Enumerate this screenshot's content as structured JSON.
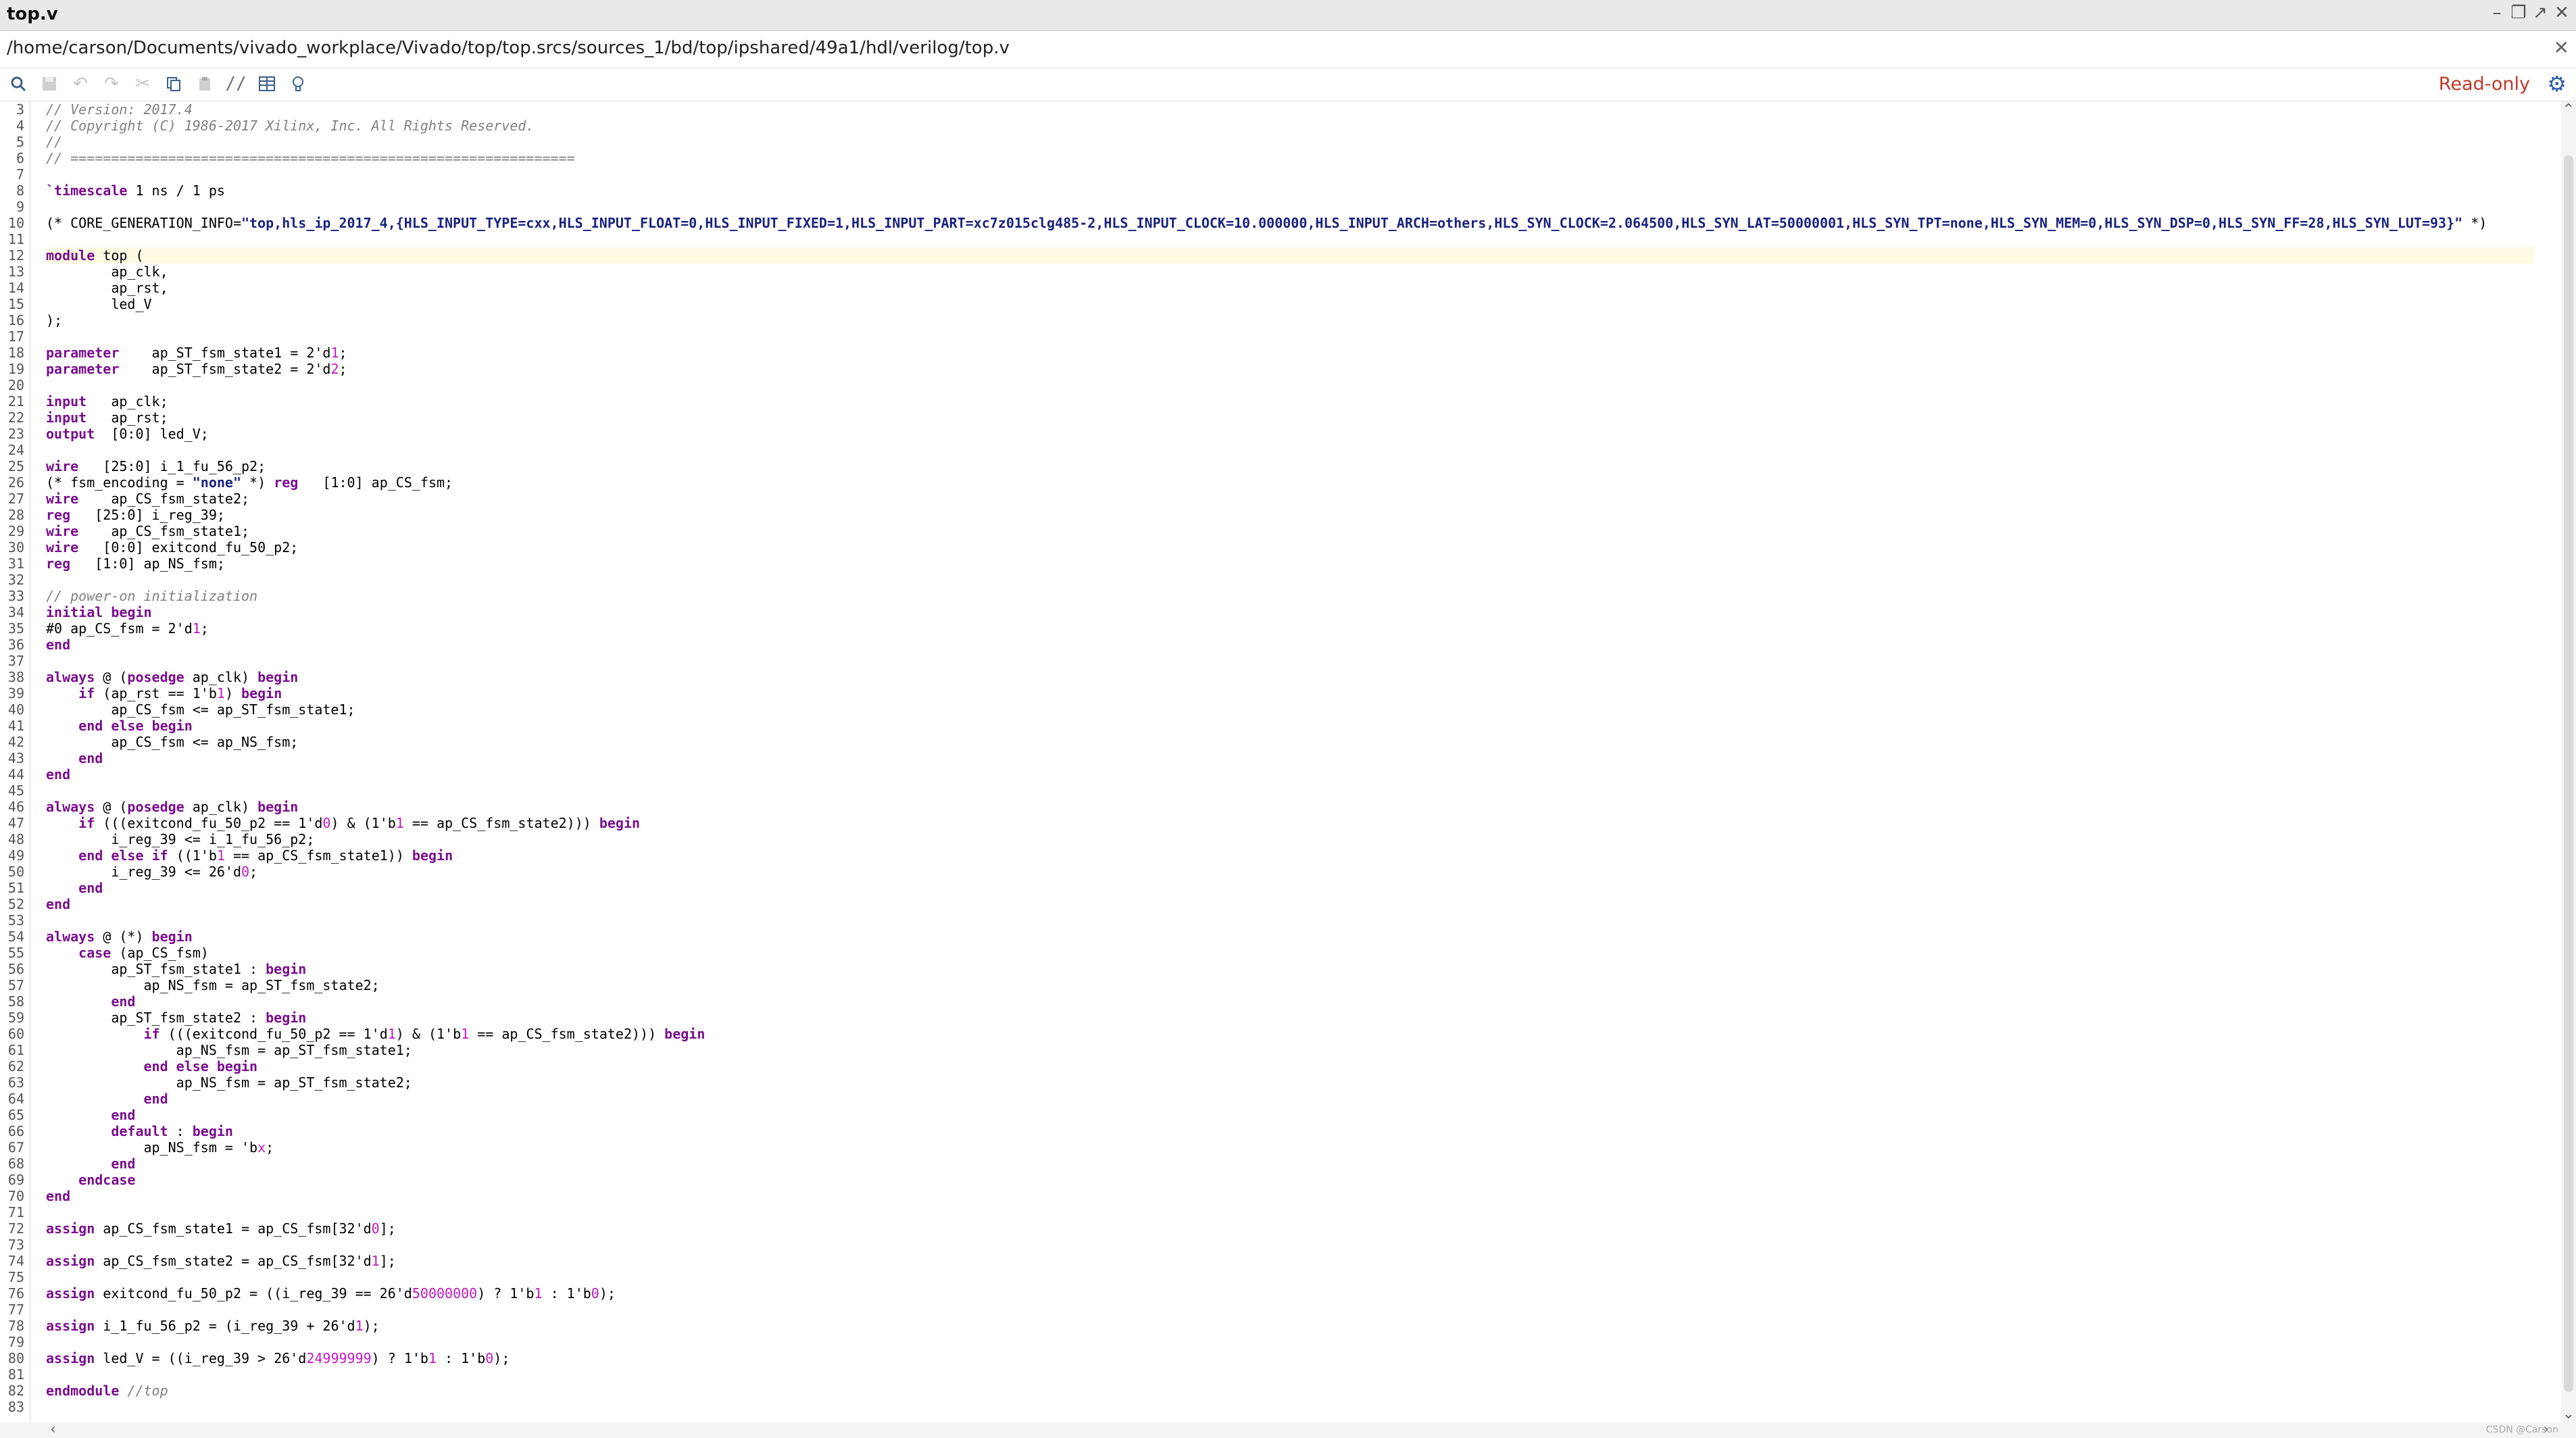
{
  "window": {
    "title": "top.v",
    "controls": [
      "minimize-icon",
      "restore-icon",
      "maximize-icon",
      "close-icon"
    ]
  },
  "path": "/home/carson/Documents/vivado_workplace/Vivado/top/top.srcs/sources_1/bd/top/ipshared/49a1/hdl/verilog/top.v",
  "toolbar": {
    "icons": [
      "search-icon",
      "save-icon",
      "undo-icon",
      "redo-icon",
      "cut-icon",
      "copy-icon",
      "paste-icon",
      "comment-icon",
      "columns-icon",
      "bulb-icon"
    ],
    "readonly_label": "Read-only"
  },
  "editor": {
    "current_line": 12,
    "lines": [
      {
        "n": "3",
        "t": "// Version: 2017.4"
      },
      {
        "n": "4",
        "t": "// Copyright (C) 1986-2017 Xilinx, Inc. All Rights Reserved."
      },
      {
        "n": "5",
        "t": "//"
      },
      {
        "n": "6",
        "t": "// =============================================================="
      },
      {
        "n": "7",
        "t": ""
      },
      {
        "n": "8",
        "t": "`timescale 1 ns / 1 ps"
      },
      {
        "n": "9",
        "t": ""
      },
      {
        "n": "10",
        "t": "(* CORE_GENERATION_INFO=\"top,hls_ip_2017_4,{HLS_INPUT_TYPE=cxx,HLS_INPUT_FLOAT=0,HLS_INPUT_FIXED=1,HLS_INPUT_PART=xc7z015clg485-2,HLS_INPUT_CLOCK=10.000000,HLS_INPUT_ARCH=others,HLS_SYN_CLOCK=2.064500,HLS_SYN_LAT=50000001,HLS_SYN_TPT=none,HLS_SYN_MEM=0,HLS_SYN_DSP=0,HLS_SYN_FF=28,HLS_SYN_LUT=93}\" *)"
      },
      {
        "n": "11",
        "t": ""
      },
      {
        "n": "12",
        "t": "module top ("
      },
      {
        "n": "13",
        "t": "        ap_clk,"
      },
      {
        "n": "14",
        "t": "        ap_rst,"
      },
      {
        "n": "15",
        "t": "        led_V"
      },
      {
        "n": "16",
        "t": ");"
      },
      {
        "n": "17",
        "t": ""
      },
      {
        "n": "18",
        "t": "parameter    ap_ST_fsm_state1 = 2'd1;"
      },
      {
        "n": "19",
        "t": "parameter    ap_ST_fsm_state2 = 2'd2;"
      },
      {
        "n": "20",
        "t": ""
      },
      {
        "n": "21",
        "t": "input   ap_clk;"
      },
      {
        "n": "22",
        "t": "input   ap_rst;"
      },
      {
        "n": "23",
        "t": "output  [0:0] led_V;"
      },
      {
        "n": "24",
        "t": ""
      },
      {
        "n": "25",
        "t": "wire   [25:0] i_1_fu_56_p2;"
      },
      {
        "n": "26",
        "t": "(* fsm_encoding = \"none\" *) reg   [1:0] ap_CS_fsm;"
      },
      {
        "n": "27",
        "t": "wire    ap_CS_fsm_state2;"
      },
      {
        "n": "28",
        "t": "reg   [25:0] i_reg_39;"
      },
      {
        "n": "29",
        "t": "wire    ap_CS_fsm_state1;"
      },
      {
        "n": "30",
        "t": "wire   [0:0] exitcond_fu_50_p2;"
      },
      {
        "n": "31",
        "t": "reg   [1:0] ap_NS_fsm;"
      },
      {
        "n": "32",
        "t": ""
      },
      {
        "n": "33",
        "t": "// power-on initialization"
      },
      {
        "n": "34",
        "t": "initial begin"
      },
      {
        "n": "35",
        "t": "#0 ap_CS_fsm = 2'd1;"
      },
      {
        "n": "36",
        "t": "end"
      },
      {
        "n": "37",
        "t": ""
      },
      {
        "n": "38",
        "t": "always @ (posedge ap_clk) begin"
      },
      {
        "n": "39",
        "t": "    if (ap_rst == 1'b1) begin"
      },
      {
        "n": "40",
        "t": "        ap_CS_fsm <= ap_ST_fsm_state1;"
      },
      {
        "n": "41",
        "t": "    end else begin"
      },
      {
        "n": "42",
        "t": "        ap_CS_fsm <= ap_NS_fsm;"
      },
      {
        "n": "43",
        "t": "    end"
      },
      {
        "n": "44",
        "t": "end"
      },
      {
        "n": "45",
        "t": ""
      },
      {
        "n": "46",
        "t": "always @ (posedge ap_clk) begin"
      },
      {
        "n": "47",
        "t": "    if (((exitcond_fu_50_p2 == 1'd0) & (1'b1 == ap_CS_fsm_state2))) begin"
      },
      {
        "n": "48",
        "t": "        i_reg_39 <= i_1_fu_56_p2;"
      },
      {
        "n": "49",
        "t": "    end else if ((1'b1 == ap_CS_fsm_state1)) begin"
      },
      {
        "n": "50",
        "t": "        i_reg_39 <= 26'd0;"
      },
      {
        "n": "51",
        "t": "    end"
      },
      {
        "n": "52",
        "t": "end"
      },
      {
        "n": "53",
        "t": ""
      },
      {
        "n": "54",
        "t": "always @ (*) begin"
      },
      {
        "n": "55",
        "t": "    case (ap_CS_fsm)"
      },
      {
        "n": "56",
        "t": "        ap_ST_fsm_state1 : begin"
      },
      {
        "n": "57",
        "t": "            ap_NS_fsm = ap_ST_fsm_state2;"
      },
      {
        "n": "58",
        "t": "        end"
      },
      {
        "n": "59",
        "t": "        ap_ST_fsm_state2 : begin"
      },
      {
        "n": "60",
        "t": "            if (((exitcond_fu_50_p2 == 1'd1) & (1'b1 == ap_CS_fsm_state2))) begin"
      },
      {
        "n": "61",
        "t": "                ap_NS_fsm = ap_ST_fsm_state1;"
      },
      {
        "n": "62",
        "t": "            end else begin"
      },
      {
        "n": "63",
        "t": "                ap_NS_fsm = ap_ST_fsm_state2;"
      },
      {
        "n": "64",
        "t": "            end"
      },
      {
        "n": "65",
        "t": "        end"
      },
      {
        "n": "66",
        "t": "        default : begin"
      },
      {
        "n": "67",
        "t": "            ap_NS_fsm = 'bx;"
      },
      {
        "n": "68",
        "t": "        end"
      },
      {
        "n": "69",
        "t": "    endcase"
      },
      {
        "n": "70",
        "t": "end"
      },
      {
        "n": "71",
        "t": ""
      },
      {
        "n": "72",
        "t": "assign ap_CS_fsm_state1 = ap_CS_fsm[32'd0];"
      },
      {
        "n": "73",
        "t": ""
      },
      {
        "n": "74",
        "t": "assign ap_CS_fsm_state2 = ap_CS_fsm[32'd1];"
      },
      {
        "n": "75",
        "t": ""
      },
      {
        "n": "76",
        "t": "assign exitcond_fu_50_p2 = ((i_reg_39 == 26'd50000000) ? 1'b1 : 1'b0);"
      },
      {
        "n": "77",
        "t": ""
      },
      {
        "n": "78",
        "t": "assign i_1_fu_56_p2 = (i_reg_39 + 26'd1);"
      },
      {
        "n": "79",
        "t": ""
      },
      {
        "n": "80",
        "t": "assign led_V = ((i_reg_39 > 26'd24999999) ? 1'b1 : 1'b0);"
      },
      {
        "n": "81",
        "t": ""
      },
      {
        "n": "82",
        "t": "endmodule //top"
      },
      {
        "n": "83",
        "t": ""
      }
    ]
  },
  "watermark": "CSDN @Carson"
}
